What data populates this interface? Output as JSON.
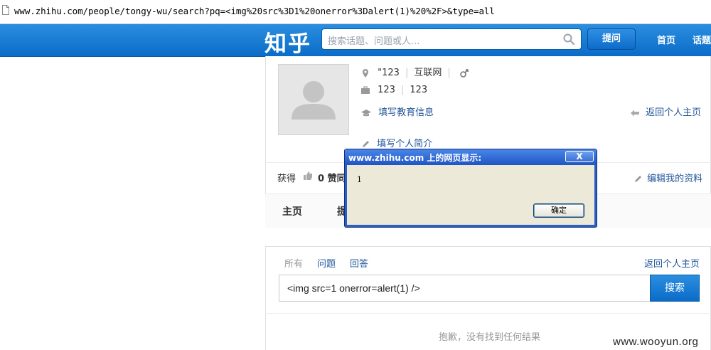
{
  "address_bar": {
    "url": "www.zhihu.com/people/tongy-wu/search?pq=<img%20src%3D1%20onerror%3Dalert(1)%20%2F>&type=all"
  },
  "topnav": {
    "logo": "知乎",
    "search_placeholder": "搜索话题、问题或人...",
    "ask_button": "提问",
    "links": [
      "首页",
      "话题"
    ]
  },
  "profile": {
    "location": "\"123",
    "industry": "互联网",
    "gender_icon": "male-icon",
    "company": "123",
    "position": "123",
    "education_link": "填写教育信息",
    "back_link": "返回个人主页",
    "bio_link": "填写个人简介",
    "stats_prefix": "获得",
    "likes": "0 赞同",
    "edit_link": "编辑我的资料",
    "tabs": [
      "主页",
      "提"
    ]
  },
  "search_panel": {
    "filters": [
      "所有",
      "问题",
      "回答"
    ],
    "back_link": "返回个人主页",
    "query_value": "<img src=1 onerror=alert(1) />",
    "search_button": "搜索",
    "empty_message": "抱歉，没有找到任何结果"
  },
  "dialog": {
    "title": "www.zhihu.com 上的网页显示:",
    "close": "X",
    "message": "1",
    "ok_button": "确定"
  },
  "watermark": "www.wooyun.org",
  "colors": {
    "nav_blue": "#0a6cc7",
    "link_blue": "#225599",
    "dialog_title": "#1f55c4",
    "dialog_body": "#ece9d8"
  }
}
